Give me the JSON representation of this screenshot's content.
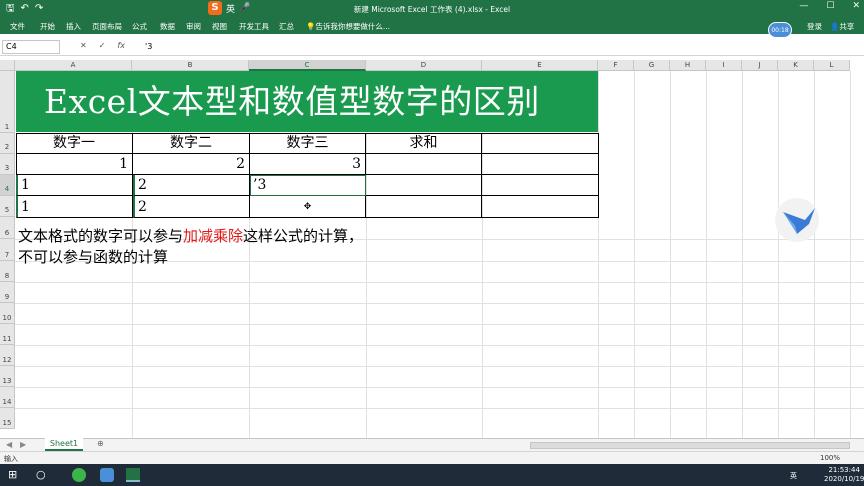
{
  "window": {
    "title": "新建 Microsoft Excel 工作表 (4).xlsx - Excel",
    "timer": "00:18"
  },
  "ime": {
    "logo": "S",
    "mode": "英"
  },
  "menu": {
    "items": [
      "文件",
      "开始",
      "插入",
      "页面布局",
      "公式",
      "数据",
      "审阅",
      "视图",
      "开发工具",
      "汇总"
    ],
    "tell_me": "告诉我你想要做什么...",
    "login": "登录",
    "share": "共享"
  },
  "formula_bar": {
    "name_box": "C4",
    "content": "'3"
  },
  "columns": [
    "A",
    "B",
    "C",
    "D",
    "E",
    "F",
    "G",
    "H",
    "I",
    "J",
    "K",
    "L"
  ],
  "rows": [
    "1",
    "2",
    "3",
    "4",
    "5",
    "6",
    "7",
    "8",
    "9",
    "10",
    "11",
    "12",
    "13",
    "14",
    "15"
  ],
  "banner": "Excel文本型和数值型数字的区别",
  "table": {
    "headers": [
      "数字一",
      "数字二",
      "数字三",
      "求和",
      ""
    ],
    "row3": [
      "1",
      "2",
      "3",
      "",
      ""
    ],
    "row4": [
      "1",
      "2",
      "’3",
      "",
      ""
    ],
    "row5": [
      "1",
      "2",
      "",
      "",
      ""
    ]
  },
  "note": {
    "line1_a": "文本格式的数字可以参与",
    "line1_red": "加减乘除",
    "line1_b": "这样公式的计算，",
    "line2": "不可以参与函数的计算"
  },
  "sheets": {
    "active": "Sheet1"
  },
  "status": {
    "mode": "输入",
    "zoom": "100%"
  },
  "taskbar": {
    "time": "21:53:44",
    "date": "2020/10/19",
    "lang": "英"
  },
  "colors": {
    "excel_green": "#217346",
    "banner_green": "#1a9a4e",
    "highlight_red": "#e21818"
  }
}
